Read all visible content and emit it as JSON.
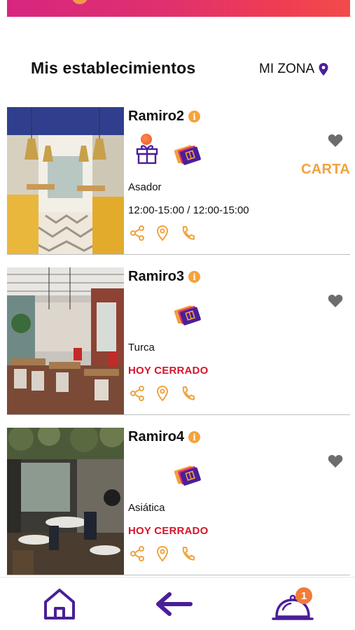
{
  "header": {
    "title": "Mis establecimientos",
    "zone_label": "MI ZONA"
  },
  "colors": {
    "brand_purple": "#4a1f9a",
    "accent_orange": "#f0a33e",
    "closed_red": "#d5162b",
    "banner_pink": "#e0306f"
  },
  "establishments": [
    {
      "name": "Ramiro2",
      "category": "Asador",
      "hours": "12:00-15:00 / 12:00-15:00",
      "carta_label": "CARTA",
      "has_gift": true,
      "favorite_icon": "heart-icon"
    },
    {
      "name": "Ramiro3",
      "category": "Turca",
      "status": "HOY CERRADO",
      "has_gift": false,
      "favorite_icon": "heart-icon"
    },
    {
      "name": "Ramiro4",
      "category": "Asiática",
      "status": "HOY CERRADO",
      "has_gift": false,
      "favorite_icon": "heart-icon"
    }
  ],
  "card_actions": [
    "share-icon",
    "location-pin-icon",
    "phone-icon"
  ],
  "bottom_nav": {
    "items": [
      "home-icon",
      "back-arrow-icon",
      "cloche-icon"
    ],
    "badge_count": "1"
  }
}
